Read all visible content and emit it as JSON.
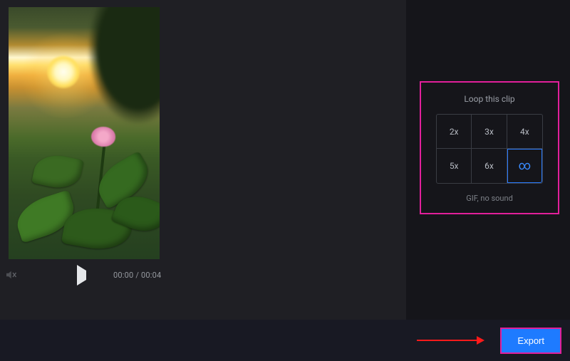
{
  "player": {
    "current_time": "00:00",
    "total_time": "00:04",
    "separator": " / ",
    "muted": true
  },
  "loop_panel": {
    "title": "Loop this clip",
    "options": [
      "2x",
      "3x",
      "4x",
      "5x",
      "6x",
      "∞"
    ],
    "selected_index": 5,
    "subtitle": "GIF, no sound"
  },
  "footer": {
    "export_label": "Export"
  },
  "annotation": {
    "highlight_color": "#e21f9b",
    "arrow_color": "#ff1a1a"
  }
}
